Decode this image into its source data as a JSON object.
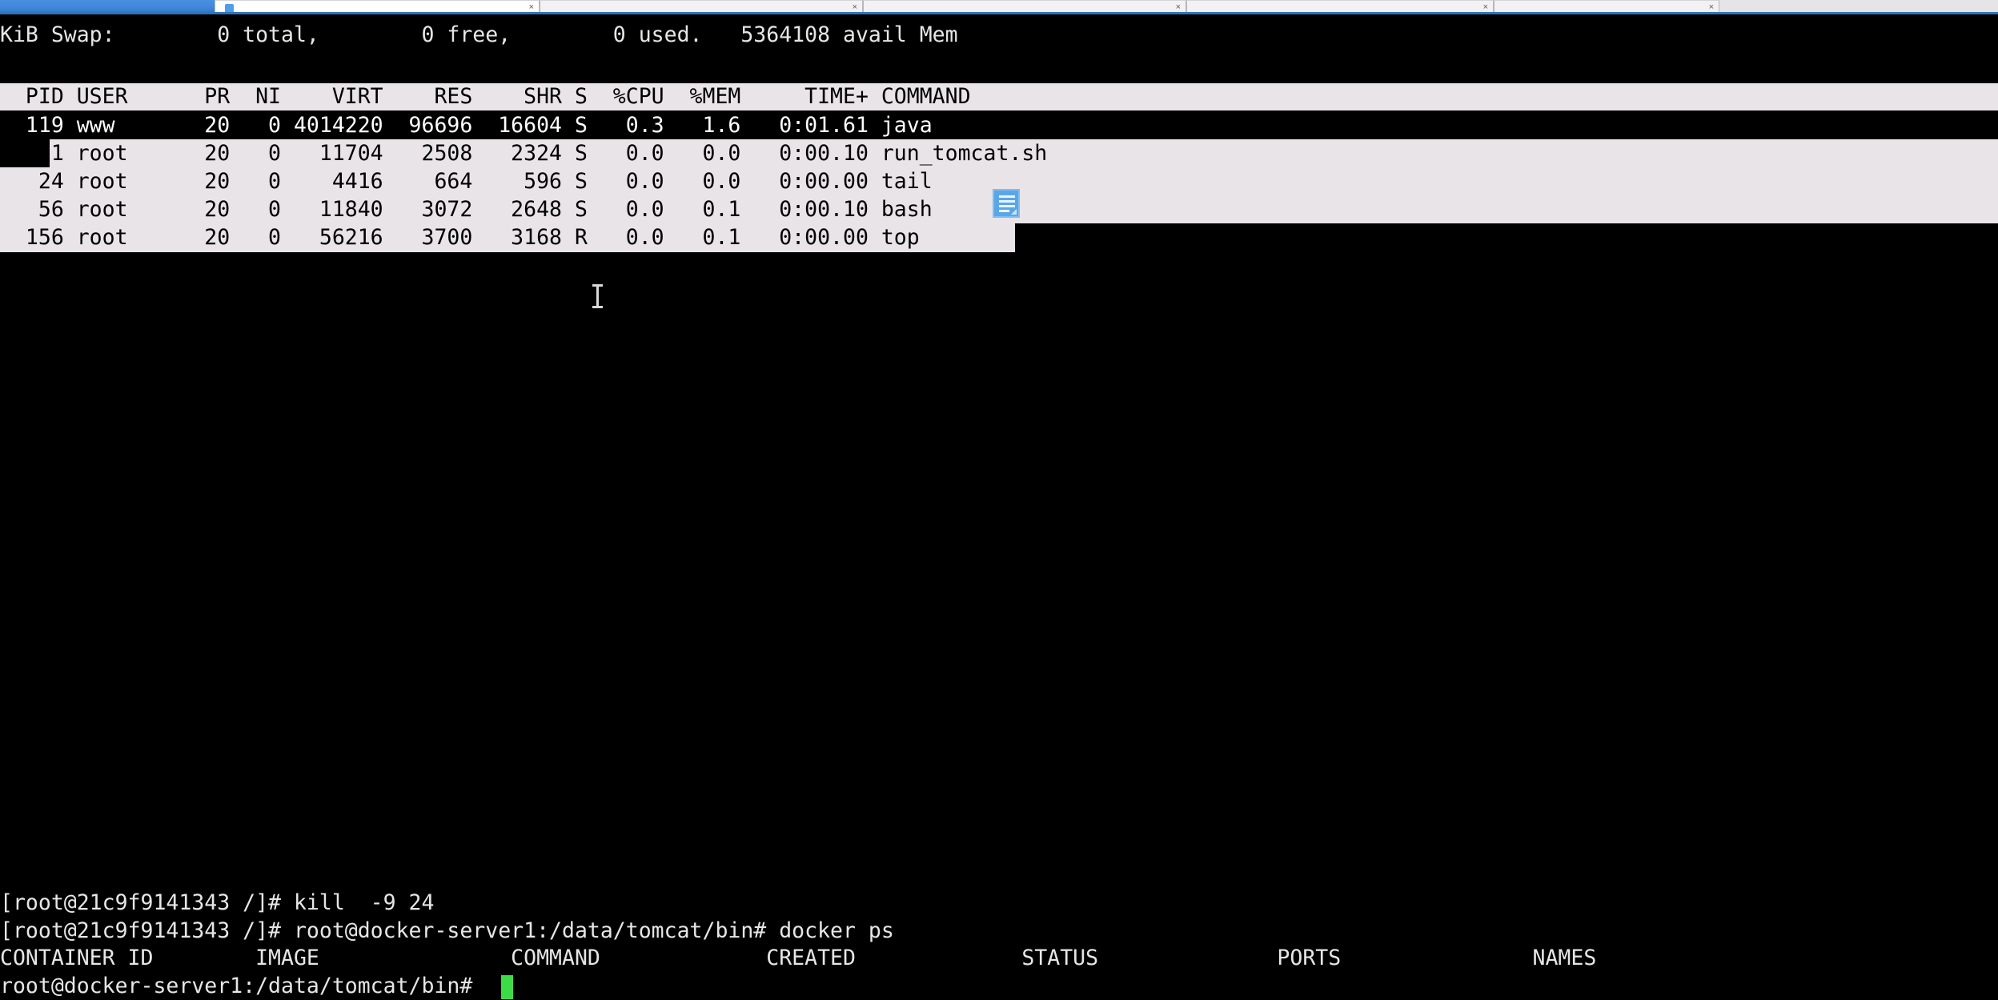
{
  "browser": {
    "tabs": [
      {
        "title": "",
        "active": true,
        "favicon": "page-icon",
        "close": "×"
      },
      {
        "title": "",
        "active": false,
        "favicon": "globe-icon",
        "close": "×"
      },
      {
        "title": "",
        "active": false,
        "favicon": "document-icon",
        "close": "×"
      },
      {
        "title": "",
        "active": false,
        "favicon": "document-icon",
        "close": "×"
      },
      {
        "title": "",
        "active": false,
        "favicon": "document-icon",
        "close": "×"
      }
    ],
    "accent_color": "#3b87d8"
  },
  "terminal": {
    "background_color": "#000000",
    "foreground_color": "#e6e6e6",
    "selection_background": "#e8e4e8",
    "selection_foreground": "#000000",
    "cursor_color": "#3ddc46",
    "top": {
      "swap_line": "KiB Swap:        0 total,        0 free,        0 used.   5364108 avail Mem",
      "swap_fields": {
        "label": "KiB Swap:",
        "total": "0 total,",
        "free": "0 free,",
        "used": "0 used.",
        "avail": "5364108 avail Mem"
      },
      "columns_line": "  PID USER      PR  NI    VIRT    RES    SHR S  %CPU  %MEM     TIME+ COMMAND",
      "columns": [
        "PID",
        "USER",
        "PR",
        "NI",
        "VIRT",
        "RES",
        "SHR",
        "S",
        "%CPU",
        "%MEM",
        "TIME+",
        "COMMAND"
      ],
      "rows": [
        {
          "line": "  119 www       20   0 4014220  96696  16604 S   0.3   1.6   0:01.61 java",
          "pid": "119",
          "user": "www",
          "pr": "20",
          "ni": "0",
          "virt": "4014220",
          "res": "96696",
          "shr": "16604",
          "s": "S",
          "cpu": "0.3",
          "mem": "1.6",
          "time": "0:01.61",
          "command": "java",
          "selected": false
        },
        {
          "line": "    1 root      20   0   11704   2508   2324 S   0.0   0.0   0:00.10 run_tomcat.sh",
          "pid": "1",
          "user": "root",
          "pr": "20",
          "ni": "0",
          "virt": "11704",
          "res": "2508",
          "shr": "2324",
          "s": "S",
          "cpu": "0.0",
          "mem": "0.0",
          "time": "0:00.10",
          "command": "run_tomcat.sh",
          "selected": true
        },
        {
          "line": "   24 root      20   0    4416    664    596 S   0.0   0.0   0:00.00 tail",
          "pid": "24",
          "user": "root",
          "pr": "20",
          "ni": "0",
          "virt": "4416",
          "res": "664",
          "shr": "596",
          "s": "S",
          "cpu": "0.0",
          "mem": "0.0",
          "time": "0:00.00",
          "command": "tail",
          "selected": true
        },
        {
          "line": "   56 root      20   0   11840   3072   2648 S   0.0   0.1   0:00.10 bash",
          "pid": "56",
          "user": "root",
          "pr": "20",
          "ni": "0",
          "virt": "11840",
          "res": "3072",
          "shr": "2648",
          "s": "S",
          "cpu": "0.0",
          "mem": "0.1",
          "time": "0:00.10",
          "command": "bash",
          "selected": true
        },
        {
          "line": "  156 root      20   0   56216   3700   3168 R   0.0   0.1   0:00.00 top",
          "pid": "156",
          "user": "root",
          "pr": "20",
          "ni": "0",
          "virt": "56216",
          "res": "3700",
          "shr": "3168",
          "s": "R",
          "cpu": "0.0",
          "mem": "0.1",
          "time": "0:00.00",
          "command": "top",
          "selected": true
        }
      ]
    },
    "shell": {
      "line_kill": "[root@21c9f9141343 /]# kill  -9 24",
      "line_docker_ps": "[root@21c9f9141343 /]# root@docker-server1:/data/tomcat/bin# docker ps",
      "docker_ps_header": "CONTAINER ID        IMAGE               COMMAND             CREATED             STATUS              PORTS               NAMES",
      "docker_ps_columns": [
        "CONTAINER ID",
        "IMAGE",
        "COMMAND",
        "CREATED",
        "STATUS",
        "PORTS",
        "NAMES"
      ],
      "prompt": "root@docker-server1:/data/tomcat/bin# ",
      "cursor": "block-cursor"
    }
  },
  "pointers": {
    "text_cursor": "i-beam-cursor",
    "drag_icon": "document-drag-icon"
  }
}
